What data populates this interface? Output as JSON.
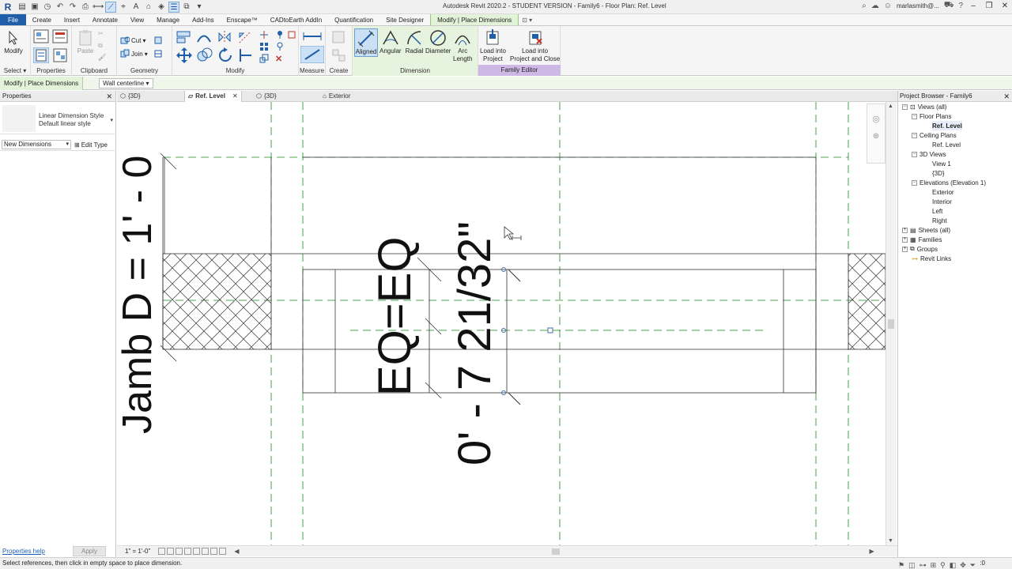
{
  "titlebar": {
    "title": "Autodesk Revit 2020.2 - STUDENT VERSION - Family6 - Floor Plan: Ref. Level",
    "user": "marlasmith@...",
    "logo": "R"
  },
  "menu": {
    "tabs": [
      "File",
      "Create",
      "Insert",
      "Annotate",
      "View",
      "Manage",
      "Add-Ins",
      "Enscape™",
      "CADtoEarth AddIn",
      "Quantification",
      "Site Designer",
      "Modify | Place Dimensions"
    ],
    "extra": "⊡ ▾"
  },
  "ribbon": {
    "modify": "Modify",
    "select": "Select ▾",
    "properties": "Properties",
    "clipboard": "Clipboard",
    "paste": "Paste",
    "cut": "Cut",
    "join": "Join",
    "geometry": "Geometry",
    "modify_group": "Modify",
    "measure": "Measure",
    "create": "Create",
    "aligned": "Aligned",
    "angular": "Angular",
    "radial": "Radial",
    "diameter": "Diameter",
    "arc_length_1": "Arc",
    "arc_length_2": "Length",
    "dimension": "Dimension",
    "load_project_1": "Load into",
    "load_project_2": "Project",
    "load_close_1": "Load into",
    "load_close_2": "Project and Close",
    "family_editor": "Family Editor"
  },
  "context": {
    "label": "Modify | Place Dimensions",
    "dropdown": "Wall centerline ▾"
  },
  "properties": {
    "title": "Properties",
    "type_name_1": "Linear Dimension Style",
    "type_name_2": "Default linear style",
    "instance_dropdown": "New Dimensions",
    "edit_type": "Edit Type",
    "help": "Properties help",
    "apply": "Apply"
  },
  "viewtabs": [
    {
      "label": "{3D}"
    },
    {
      "label": "Ref. Level"
    },
    {
      "label": "{3D}"
    },
    {
      "label": "Exterior"
    }
  ],
  "canvas": {
    "text_jamb": "Jamb D = 1' - 0",
    "text_eq": "EQ=EQ",
    "text_dim": "0' - 7 21/32\""
  },
  "viewbar": {
    "scale": "1\" = 1'-0\""
  },
  "browser": {
    "title": "Project Browser - Family6",
    "nodes": [
      {
        "label": "Views (all)"
      },
      {
        "label": "Floor Plans"
      },
      {
        "label": "Ref. Level"
      },
      {
        "label": "Ceiling Plans"
      },
      {
        "label": "Ref. Level"
      },
      {
        "label": "3D Views"
      },
      {
        "label": "View 1"
      },
      {
        "label": "{3D}"
      },
      {
        "label": "Elevations (Elevation 1)"
      },
      {
        "label": "Exterior"
      },
      {
        "label": "Interior"
      },
      {
        "label": "Left"
      },
      {
        "label": "Right"
      },
      {
        "label": "Sheets (all)"
      },
      {
        "label": "Families"
      },
      {
        "label": "Groups"
      },
      {
        "label": "Revit Links"
      }
    ]
  },
  "status": {
    "text": "Select references, then click in empty space to place dimension.",
    "zero": ":0"
  },
  "colors": {
    "accent": "#1f5ea8",
    "context_green": "#e2f3da",
    "family_editor": "#cdb8e6",
    "ref_plane": "#1a8a1a"
  }
}
